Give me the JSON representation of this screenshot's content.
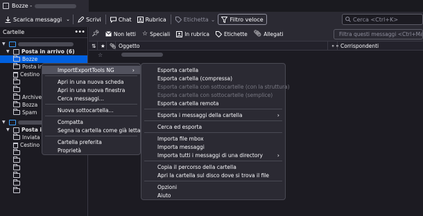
{
  "window": {
    "tab_title": "Bozze -"
  },
  "toolbar": {
    "get_messages": "Scarica messaggi",
    "write": "Scrivi",
    "chat": "Chat",
    "address_book": "Rubrica",
    "tag": "Etichetta",
    "quick_filter": "Filtro veloce",
    "search_placeholder": "Cerca <Ctrl+K>"
  },
  "folder_pane": {
    "header": "Cartelle",
    "account1": {
      "inbox": "Posta in arrivo (6)",
      "folders": [
        "Bozze",
        "Posta in",
        "Cestino",
        "",
        "",
        "Archive",
        "Bozza",
        "Spam"
      ]
    },
    "account2": {
      "inbox": "Posta in",
      "folders": [
        "Inviata",
        "Cestino"
      ]
    }
  },
  "filter_bar": {
    "unread": "Non letti",
    "starred": "Speciali",
    "contact": "In rubrica",
    "tags": "Etichette",
    "attachments": "Allegati",
    "search_placeholder": "Filtra questi messaggi <Ctrl+Maiu"
  },
  "message_list": {
    "columns": {
      "subject": "Oggetto",
      "correspondents": "Corrispondenti"
    }
  },
  "context_menu": {
    "items": [
      {
        "label": "ImportExportTools NG",
        "submenu": true,
        "highlighted": true
      },
      {
        "sep": true
      },
      {
        "label": "Apri in una nuova scheda"
      },
      {
        "label": "Apri in una nuova finestra"
      },
      {
        "label": "Cerca messaggi..."
      },
      {
        "sep": true
      },
      {
        "label": "Nuova sottocartella..."
      },
      {
        "sep": true
      },
      {
        "label": "Compatta"
      },
      {
        "label": "Segna la cartella come già letta"
      },
      {
        "sep": true
      },
      {
        "label": "Cartella preferita"
      },
      {
        "label": "Proprietà"
      }
    ]
  },
  "submenu": {
    "items": [
      {
        "label": "Esporta cartella"
      },
      {
        "label": "Esporta cartella (compressa)"
      },
      {
        "label": "Esporta cartella con sottocartelle (con la struttura)",
        "disabled": true
      },
      {
        "label": "Esporta cartella con sottocartelle (semplice)",
        "disabled": true
      },
      {
        "label": "Esporta cartella remota"
      },
      {
        "sep": true
      },
      {
        "label": "Esporta i messaggi della cartella",
        "submenu": true
      },
      {
        "sep": true
      },
      {
        "label": "Cerca ed esporta"
      },
      {
        "sep": true
      },
      {
        "label": "Importa file mbox"
      },
      {
        "label": "Importa messaggi"
      },
      {
        "label": "Importa tutti i messaggi di una directory",
        "submenu": true
      },
      {
        "sep": true
      },
      {
        "label": "Copia il percorso della cartella"
      },
      {
        "label": "Apri la cartella sul disco dove si trova il file"
      },
      {
        "sep": true
      },
      {
        "label": "Opzioni"
      },
      {
        "label": "Aiuto"
      }
    ]
  }
}
